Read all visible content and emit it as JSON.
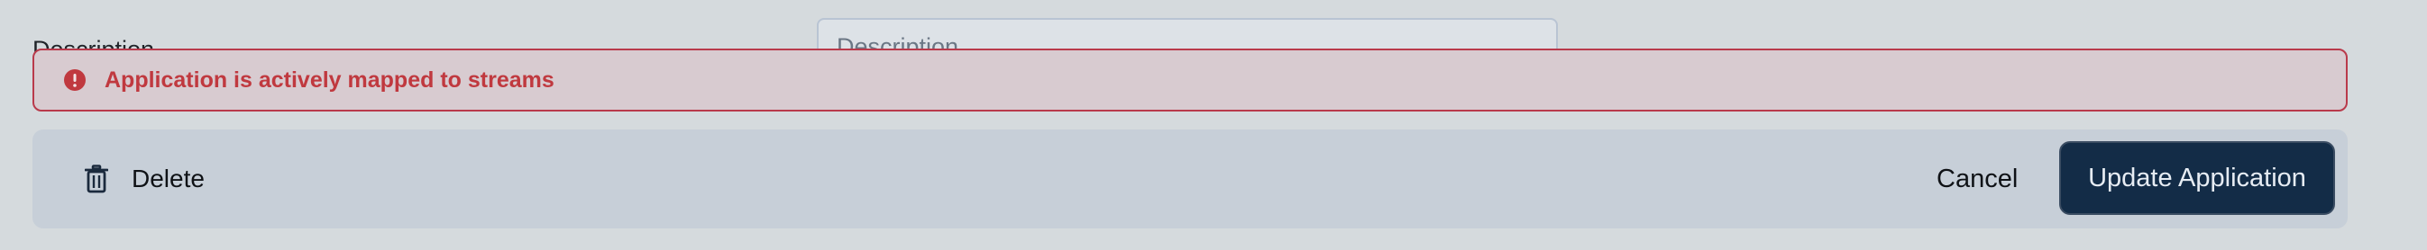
{
  "form": {
    "description_label": "Description",
    "description_placeholder": "Description"
  },
  "error": {
    "icon": "alert-circle-icon",
    "message": "Application is actively mapped to streams",
    "color": "#c0393f"
  },
  "actions": {
    "delete_icon": "trash-icon",
    "delete_label": "Delete",
    "cancel_label": "Cancel",
    "update_label": "Update Application",
    "update_color": "#132c47"
  }
}
